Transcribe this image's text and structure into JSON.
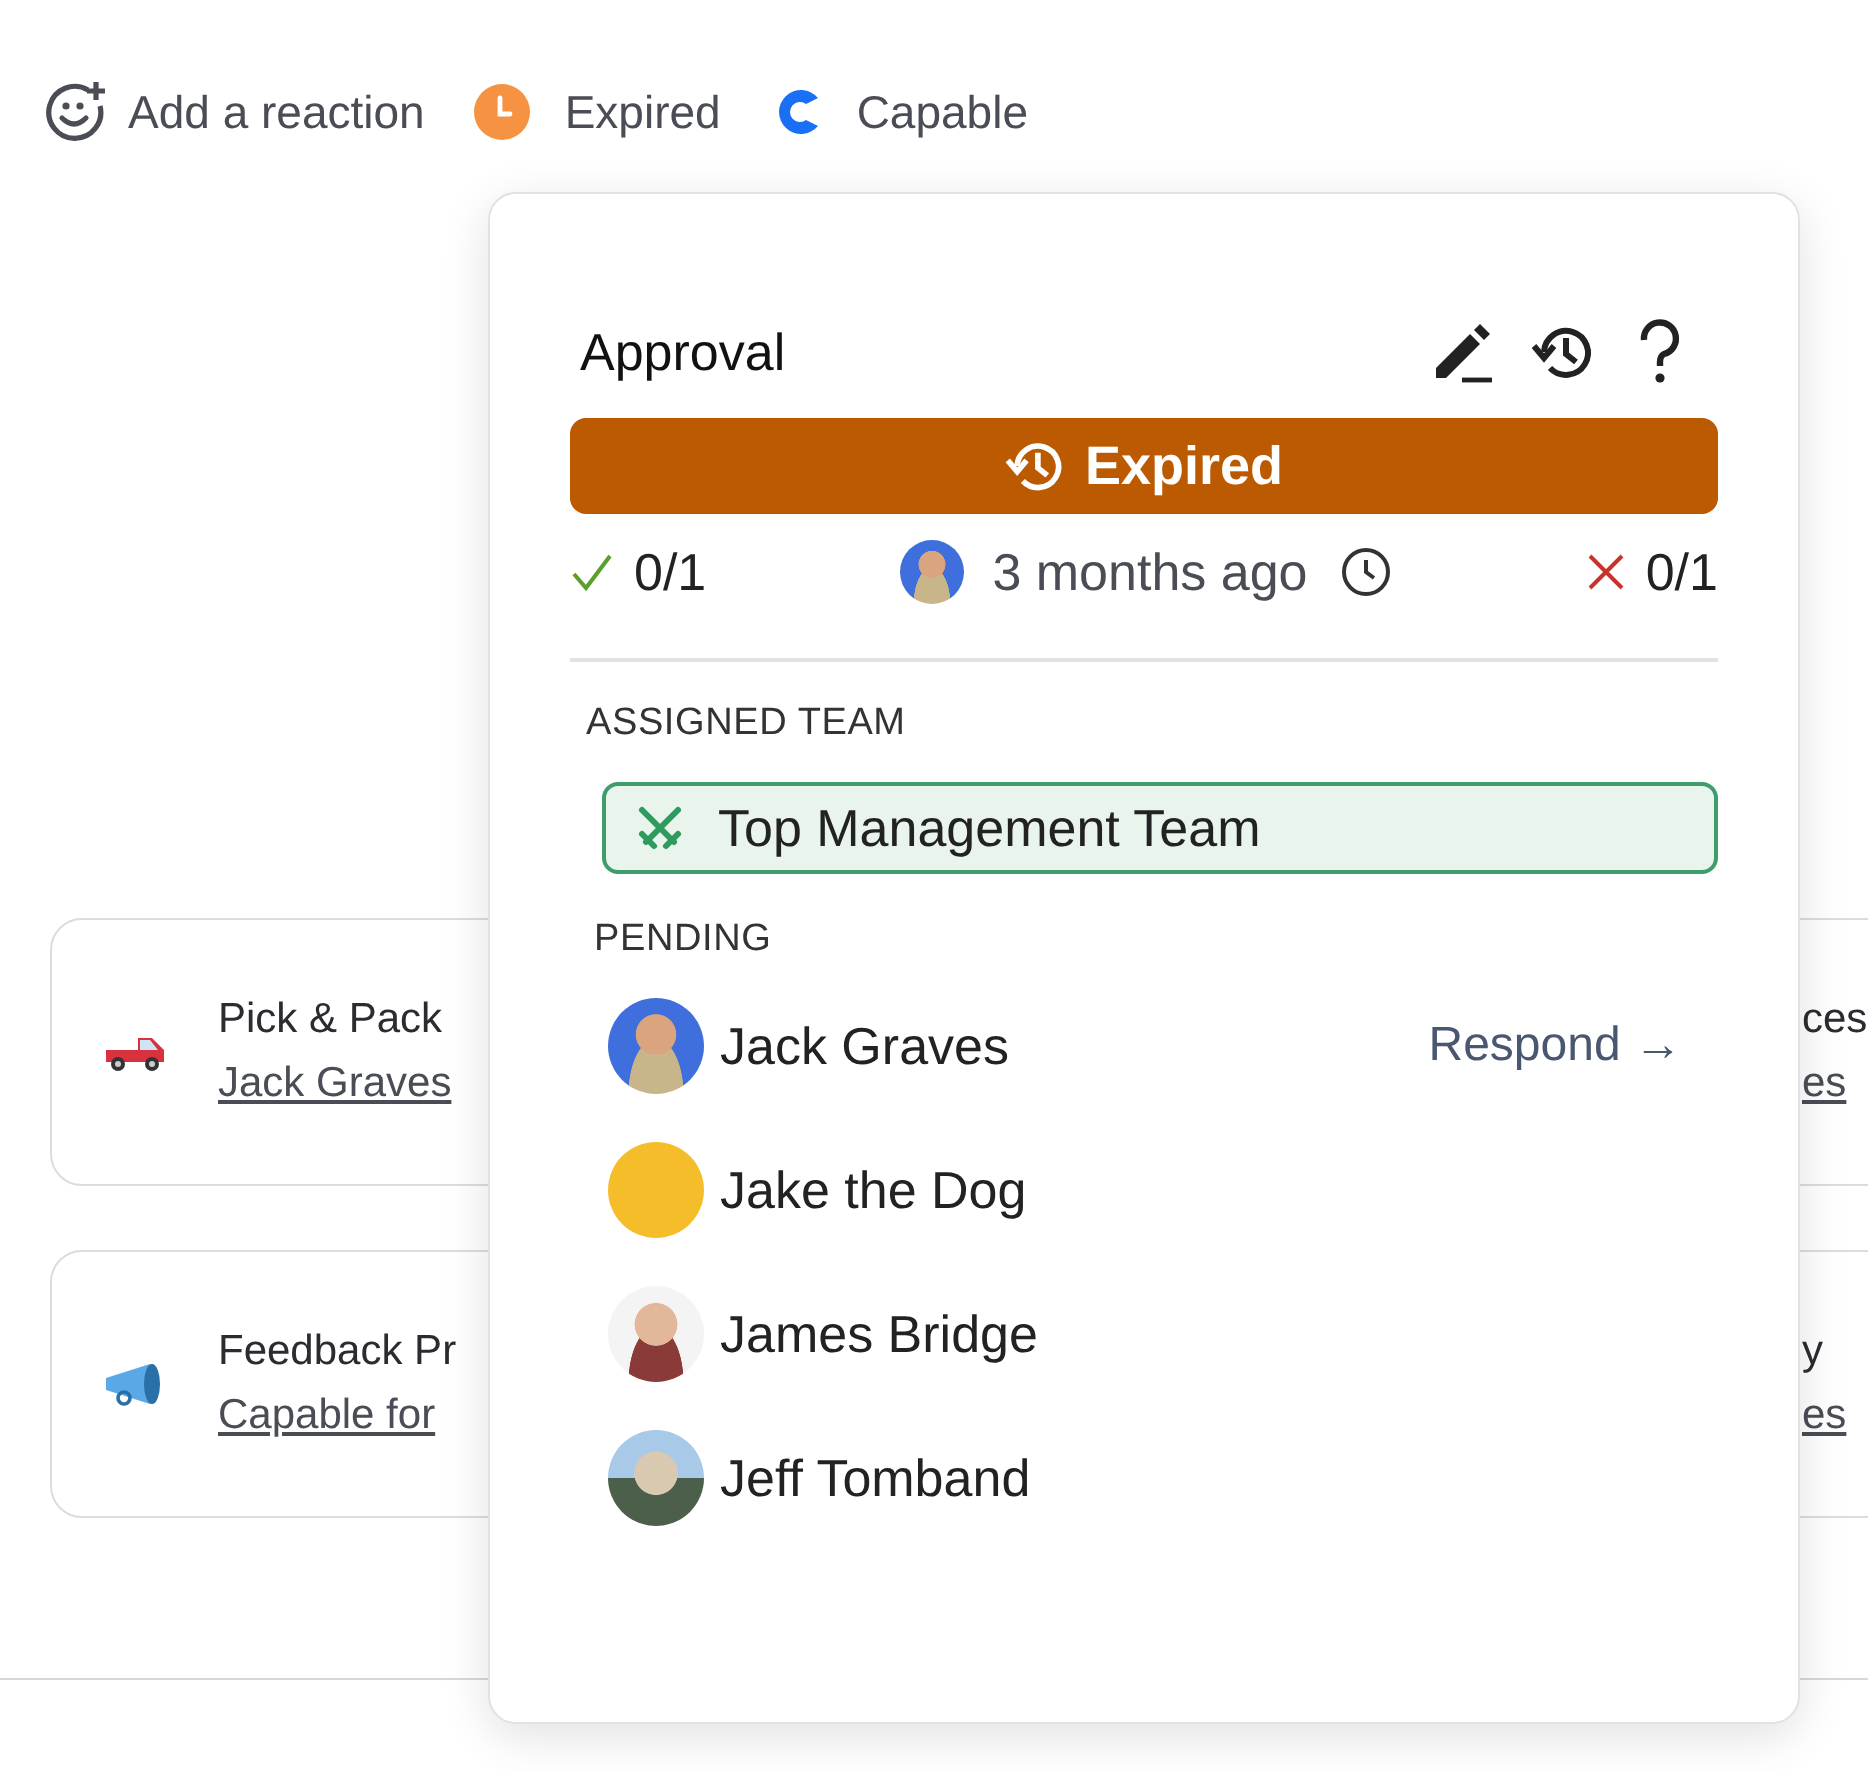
{
  "reactions": [
    {
      "kind": "add",
      "label": "Add a reaction"
    },
    {
      "kind": "expired",
      "label": "Expired"
    },
    {
      "kind": "app",
      "label": "Capable"
    }
  ],
  "cards": [
    {
      "kind": "truck",
      "title": "Pick & Pack",
      "link": "Jack Graves",
      "side_title": "ces",
      "side_link": "es"
    },
    {
      "kind": "megaphone",
      "title": "Feedback Pr",
      "link": "Capable for",
      "side_title": "y",
      "side_link": "es"
    }
  ],
  "popover": {
    "title": "Approval",
    "status": {
      "kind": "expired",
      "label": "Expired"
    },
    "approved": "0/1",
    "time": "3 months ago",
    "rejected": "0/1",
    "team_heading": "ASSIGNED TEAM",
    "team": "Top Management Team",
    "pending_heading": "PENDING",
    "pending": [
      {
        "name": "Jack Graves",
        "action": "Respond →"
      },
      {
        "name": "Jake the Dog"
      },
      {
        "name": "James Bridge"
      },
      {
        "name": "Jeff Tomband"
      }
    ]
  }
}
